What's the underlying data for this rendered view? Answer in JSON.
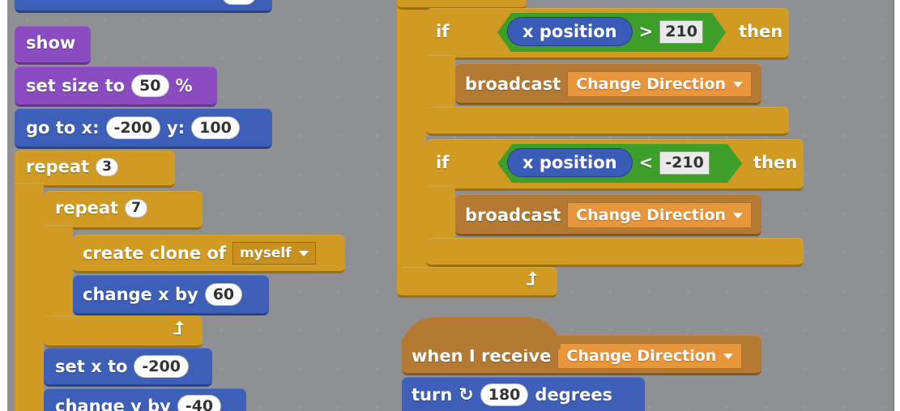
{
  "colors": {
    "looks": "#8a4cc0",
    "motion": "#3d5fb8",
    "control": "#d09a23",
    "events": "#b47a33",
    "operators": "#3e9e2a"
  },
  "left_script": {
    "show": "show",
    "set_size": {
      "label": "set size to",
      "value": "50",
      "unit": "%"
    },
    "go_to": {
      "label_x": "go to x:",
      "x": "-200",
      "label_y": "y:",
      "y": "100"
    },
    "repeat_outer": {
      "label": "repeat",
      "value": "3"
    },
    "repeat_inner": {
      "label": "repeat",
      "value": "7"
    },
    "create_clone": {
      "label": "create clone of",
      "option": "myself"
    },
    "change_x": {
      "label": "change x by",
      "value": "60"
    },
    "set_x": {
      "label": "set x to",
      "value": "-200"
    },
    "change_y": {
      "label": "change y by",
      "value": "-40"
    }
  },
  "right_script": {
    "if1": {
      "if": "if",
      "reporter": "x position",
      "op": ">",
      "value": "210",
      "then": "then"
    },
    "broadcast1": {
      "label": "broadcast",
      "option": "Change Direction"
    },
    "if2": {
      "if": "if",
      "reporter": "x position",
      "op": "<",
      "value": "-210",
      "then": "then"
    },
    "broadcast2": {
      "label": "broadcast",
      "option": "Change Direction"
    },
    "hat": {
      "label": "when I receive",
      "option": "Change Direction"
    },
    "turn": {
      "label": "turn",
      "value": "180",
      "unit": "degrees"
    }
  }
}
